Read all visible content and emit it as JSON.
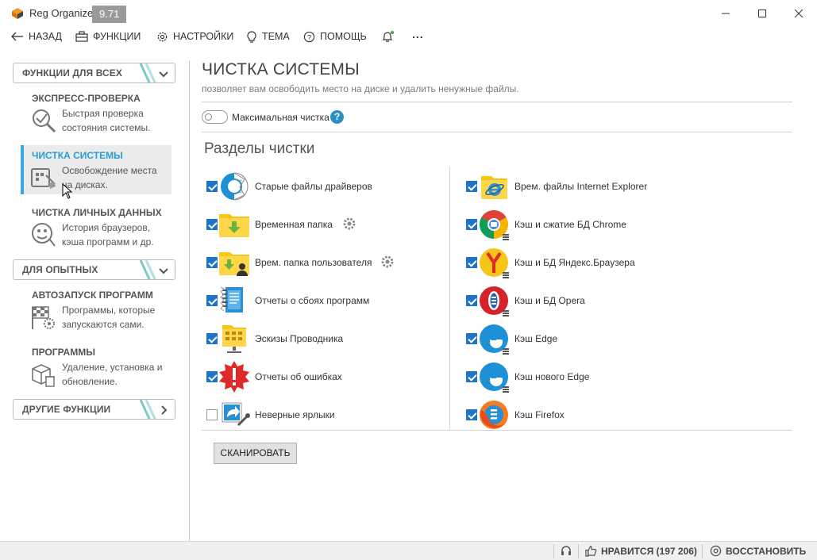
{
  "window": {
    "title": "Reg Organizer",
    "version": "9.71"
  },
  "toolbar": {
    "back": "НАЗАД",
    "functions": "ФУНКЦИИ",
    "settings": "НАСТРОЙКИ",
    "theme": "ТЕМА",
    "help": "ПОМОЩЬ",
    "more": "..."
  },
  "sidebar": {
    "group_all": "ФУНКЦИИ ДЛЯ ВСЕХ",
    "group_advanced": "ДЛЯ ОПЫТНЫХ",
    "group_other": "ДРУГИЕ ФУНКЦИИ",
    "items": [
      {
        "title": "ЭКСПРЕСС-ПРОВЕРКА",
        "desc": "Быстрая проверка состояния системы."
      },
      {
        "title": "ЧИСТКА СИСТЕМЫ",
        "desc": "Освобождение места на дисках."
      },
      {
        "title": "ЧИСТКА ЛИЧНЫХ ДАННЫХ",
        "desc": "История браузеров, кэша программ и др."
      },
      {
        "title": "АВТОЗАПУСК ПРОГРАММ",
        "desc": "Программы, которые запускаются сами."
      },
      {
        "title": "ПРОГРАММЫ",
        "desc": "Удаление, установка и обновление."
      }
    ]
  },
  "main": {
    "title": "ЧИСТКА СИСТЕМЫ",
    "subtitle": "позволяет вам освободить место на диске и удалить ненужные файлы.",
    "max_clean_label": "Максимальная чистка",
    "help_glyph": "?",
    "sections_title": "Разделы чистки",
    "left_items": [
      {
        "label": "Старые файлы драйверов",
        "checked": true,
        "icon": "driver-files-icon"
      },
      {
        "label": "Временная папка",
        "checked": true,
        "icon": "temp-folder-icon"
      },
      {
        "label": "Врем. папка пользователя",
        "checked": true,
        "icon": "user-temp-folder-icon"
      },
      {
        "label": "Отчеты о сбоях программ",
        "checked": true,
        "icon": "crash-reports-icon"
      },
      {
        "label": "Эскизы Проводника",
        "checked": true,
        "icon": "explorer-thumbnails-icon"
      },
      {
        "label": "Отчеты об ошибках",
        "checked": true,
        "icon": "error-reports-icon"
      },
      {
        "label": "Неверные ярлыки",
        "checked": false,
        "icon": "broken-shortcuts-icon"
      }
    ],
    "right_items": [
      {
        "label": "Врем. файлы Internet Explorer",
        "checked": true,
        "icon": "ie-files-icon"
      },
      {
        "label": "Кэш и сжатие БД Chrome",
        "checked": true,
        "icon": "chrome-icon"
      },
      {
        "label": "Кэш и БД Яндекс.Браузера",
        "checked": true,
        "icon": "yandex-browser-icon"
      },
      {
        "label": "Кэш и БД Opera",
        "checked": true,
        "icon": "opera-icon"
      },
      {
        "label": "Кэш Edge",
        "checked": true,
        "icon": "edge-icon"
      },
      {
        "label": "Кэш нового Edge",
        "checked": true,
        "icon": "new-edge-icon"
      },
      {
        "label": "Кэш Firefox",
        "checked": true,
        "icon": "firefox-icon"
      }
    ],
    "scan_button": "СКАНИРОВАТЬ"
  },
  "statusbar": {
    "likes": "НРАВИТСЯ (197 206)",
    "restore": "ВОССТАНОВИТЬ"
  },
  "colors": {
    "accent": "#2b9bd3",
    "checkbox": "#1f73c9",
    "folder": "#f5c518"
  }
}
